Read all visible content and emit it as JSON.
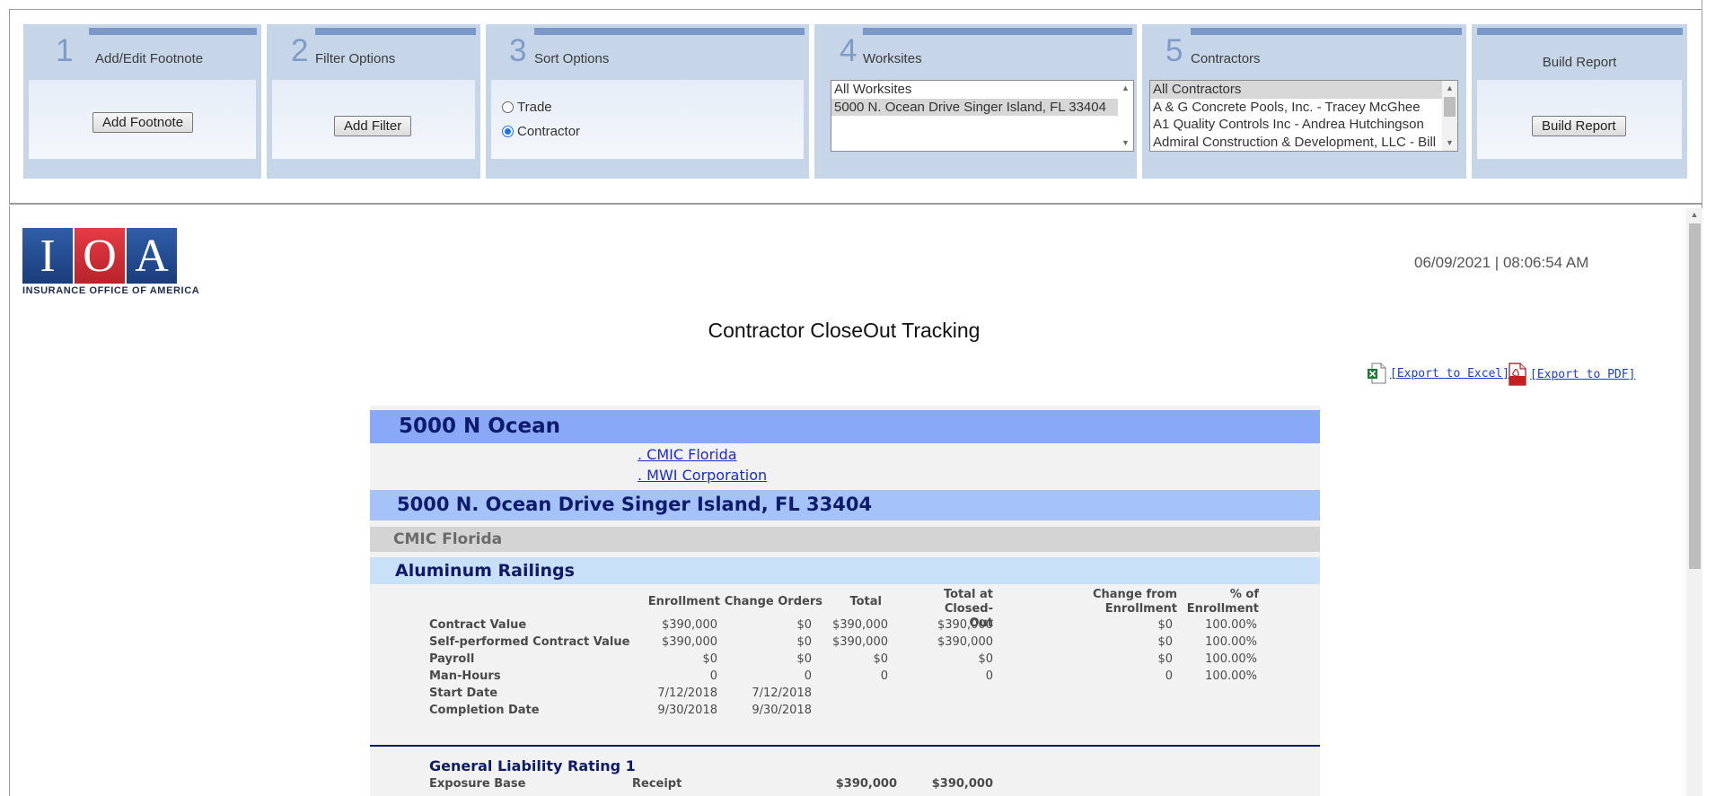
{
  "toolbar": {
    "steps": [
      {
        "num": "1",
        "title": "Add/Edit Footnote",
        "button": "Add Footnote"
      },
      {
        "num": "2",
        "title": "Filter Options",
        "button": "Add Filter"
      },
      {
        "num": "3",
        "title": "Sort Options",
        "options": [
          "Trade",
          "Contractor"
        ],
        "selected": "Contractor"
      },
      {
        "num": "4",
        "title": "Worksites",
        "items": [
          "All Worksites",
          "5000 N. Ocean Drive Singer Island, FL 33404"
        ],
        "selected": "5000 N. Ocean Drive Singer Island, FL 33404"
      },
      {
        "num": "5",
        "title": "Contractors",
        "items": [
          "All Contractors",
          "A & G Concrete Pools, Inc. - Tracey McGhee",
          "A1 Quality Controls Inc - Andrea Hutchingson",
          "Admiral Construction & Development, LLC - Bill"
        ],
        "selected": "All Contractors"
      },
      {
        "num": "",
        "title": "Build Report",
        "button": "Build Report"
      }
    ]
  },
  "header": {
    "logo_letters": [
      "I",
      "O",
      "A"
    ],
    "logo_tagline": "INSURANCE OFFICE OF AMERICA",
    "timestamp": "06/09/2021 | 08:06:54 AM",
    "title": "Contractor CloseOut Tracking",
    "export_excel": "[Export to Excel]",
    "export_pdf": "[Export to PDF]"
  },
  "report": {
    "project": "5000 N Ocean",
    "links": [
      ". CMIC Florida",
      ". MWI Corporation"
    ],
    "worksite": "5000 N. Ocean Drive Singer Island, FL 33404",
    "contractor": "CMIC Florida",
    "trade": "Aluminum Railings",
    "columns": [
      "Enrollment",
      "Change Orders",
      "Total",
      "Total at Closed-Out",
      "Change from Enrollment",
      "% of Enrollment"
    ],
    "rows": [
      {
        "label": "Contract Value",
        "cells": [
          "$390,000",
          "$0",
          "$390,000",
          "$390,000",
          "$0",
          "100.00%"
        ]
      },
      {
        "label": "Self-performed Contract Value",
        "cells": [
          "$390,000",
          "$0",
          "$390,000",
          "$390,000",
          "$0",
          "100.00%"
        ]
      },
      {
        "label": "Payroll",
        "cells": [
          "$0",
          "$0",
          "$0",
          "$0",
          "$0",
          "100.00%"
        ]
      },
      {
        "label": "Man-Hours",
        "cells": [
          "0",
          "0",
          "0",
          "0",
          "0",
          "100.00%"
        ]
      },
      {
        "label": "Start Date",
        "cells": [
          "7/12/2018",
          "7/12/2018",
          "",
          "",
          "",
          ""
        ]
      },
      {
        "label": "Completion Date",
        "cells": [
          "9/30/2018",
          "9/30/2018",
          "",
          "",
          "",
          ""
        ]
      }
    ],
    "gl_title": "General Liability Rating 1",
    "gl_row": {
      "label": "Exposure Base",
      "basis": "Receipt",
      "total": "$390,000",
      "closed": "$390,000"
    }
  },
  "colors": {
    "toolbar_panel": "#c6d5e8",
    "project_band": "#8aa8f8",
    "worksite_band": "#a6c3f9",
    "contractor_band": "#d4d4d4",
    "trade_band": "#c8e0f8",
    "heading_navy": "#0e1b6a",
    "link_blue": "#1a2bd0"
  }
}
